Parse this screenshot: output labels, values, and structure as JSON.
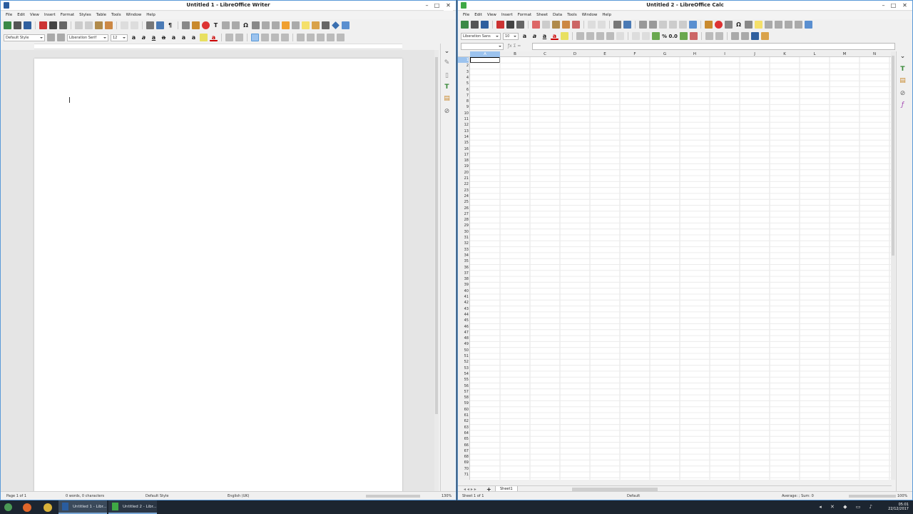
{
  "writer": {
    "title": "Untitled 1 - LibreOffice Writer",
    "menu": [
      "File",
      "Edit",
      "View",
      "Insert",
      "Format",
      "Styles",
      "Table",
      "Tools",
      "Window",
      "Help"
    ],
    "para_style": "Default Style",
    "font_name": "Liberation Serif",
    "font_size": "12",
    "status": {
      "page": "Page 1 of 1",
      "words": "0 words, 0 characters",
      "style": "Default Style",
      "lang": "English (UK)",
      "zoom": "130%"
    }
  },
  "calc": {
    "title": "Untitled 2 - LibreOffice Calc",
    "menu": [
      "File",
      "Edit",
      "View",
      "Insert",
      "Format",
      "Sheet",
      "Data",
      "Tools",
      "Window",
      "Help"
    ],
    "font_name": "Liberation Sans",
    "font_size": "10",
    "number_format": "% 0.0",
    "columns": [
      "A",
      "B",
      "C",
      "D",
      "E",
      "F",
      "G",
      "H",
      "I",
      "J",
      "K",
      "L",
      "M",
      "N"
    ],
    "rows": [
      "1",
      "2",
      "3",
      "4",
      "5",
      "6",
      "7",
      "8",
      "9",
      "10",
      "11",
      "12",
      "13",
      "14",
      "15",
      "16",
      "17",
      "18",
      "19",
      "20",
      "21",
      "22",
      "23",
      "24",
      "25",
      "26",
      "27",
      "28",
      "29",
      "30",
      "31",
      "32",
      "33",
      "34",
      "35",
      "36",
      "37",
      "38",
      "39",
      "40",
      "41",
      "42",
      "43",
      "44",
      "45",
      "46",
      "47",
      "48",
      "49",
      "50",
      "51",
      "52",
      "53",
      "54",
      "55",
      "56",
      "57",
      "58",
      "59",
      "60",
      "61",
      "62",
      "63",
      "64",
      "65",
      "66",
      "67",
      "68",
      "69",
      "70",
      "71"
    ],
    "sheet_tab": "Sheet1",
    "status": {
      "sheet": "Sheet 1 of 1",
      "style": "Default",
      "summary": "Average: ; Sum: 0",
      "zoom": "100%"
    }
  },
  "taskbar": {
    "writer_btn": "Untitled 1 - Libr...",
    "calc_btn": "Untitled 2 - Libr...",
    "time": "05:01",
    "date": "22/12/2017"
  },
  "colors": {
    "accent": "#5a9ad8",
    "writer_icon": "#2a5d9f",
    "calc_icon": "#3fa845",
    "taskbar": "#1c2530"
  }
}
